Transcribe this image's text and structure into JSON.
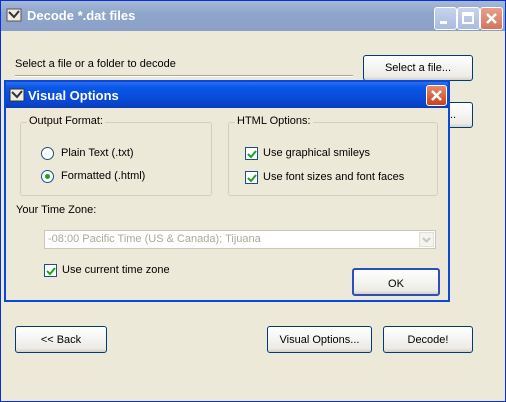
{
  "main": {
    "title": "Decode *.dat files",
    "select_prompt": "Select a file or a folder to decode",
    "select_file_button": "Select a file...",
    "hidden_button_fragment": "...",
    "back_button": "<< Back",
    "visual_options_button": "Visual Options...",
    "decode_button": "Decode!"
  },
  "dialog": {
    "title": "Visual Options",
    "output_format": {
      "legend": "Output Format:",
      "options": [
        "Plain Text (.txt)",
        "Formatted (.html)"
      ],
      "selected_index": 1
    },
    "html_options": {
      "legend": "HTML Options:",
      "checkboxes": [
        {
          "label": "Use graphical smileys",
          "checked": true
        },
        {
          "label": "Use font sizes and font faces",
          "checked": true
        }
      ]
    },
    "timezone": {
      "label": "Your Time Zone:",
      "value": "-08:00 Pacific Time (US & Canada); Tijuana",
      "use_current_label": "Use current time zone",
      "use_current_checked": true
    },
    "ok_button": "OK"
  }
}
